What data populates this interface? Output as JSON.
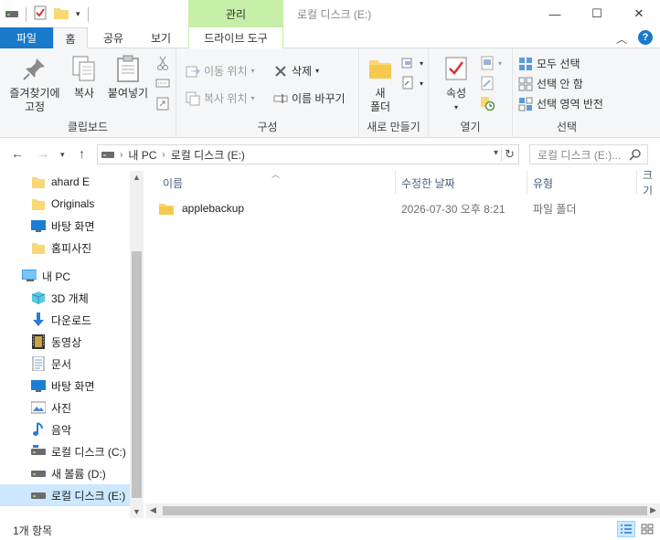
{
  "window": {
    "title": "로컬 디스크 (E:)",
    "manage_label": "관리",
    "minimize": "—",
    "maximize": "☐",
    "close": "✕"
  },
  "tabs": {
    "file": "파일",
    "home": "홈",
    "share": "공유",
    "view": "보기",
    "drive_tools": "드라이브 도구",
    "help": "?"
  },
  "ribbon": {
    "clipboard": {
      "label": "클립보드",
      "pin_line1": "즐겨찾기에",
      "pin_line2": "고정",
      "copy": "복사",
      "paste": "붙여넣기"
    },
    "organize": {
      "label": "구성",
      "move_to": "이동 위치",
      "copy_to": "복사 위치",
      "delete": "삭제",
      "rename": "이름 바꾸기"
    },
    "new": {
      "label": "새로 만들기",
      "new_folder_line1": "새",
      "new_folder_line2": "폴더"
    },
    "open": {
      "label": "열기",
      "properties": "속성"
    },
    "select": {
      "label": "선택",
      "select_all": "모두 선택",
      "select_none": "선택 안 함",
      "invert": "선택 영역 반전"
    }
  },
  "address": {
    "crumb_pc": "내 PC",
    "crumb_drive": "로컬 디스크 (E:)",
    "search_placeholder": "로컬 디스크 (E:)..."
  },
  "nav": {
    "items": [
      {
        "label": "ahard E",
        "icon": "folder-icon"
      },
      {
        "label": "Originals",
        "icon": "folder-icon"
      },
      {
        "label": "바탕 화면",
        "icon": "desktop-icon"
      },
      {
        "label": "홈피사진",
        "icon": "folder-icon"
      },
      {
        "label": "내 PC",
        "icon": "pc-icon"
      },
      {
        "label": "3D 개체",
        "icon": "cube-icon"
      },
      {
        "label": "다운로드",
        "icon": "download-icon"
      },
      {
        "label": "동영상",
        "icon": "video-icon"
      },
      {
        "label": "문서",
        "icon": "document-icon"
      },
      {
        "label": "바탕 화면",
        "icon": "desktop-icon"
      },
      {
        "label": "사진",
        "icon": "picture-icon"
      },
      {
        "label": "음악",
        "icon": "music-icon"
      },
      {
        "label": "로컬 디스크 (C:)",
        "icon": "drive-icon"
      },
      {
        "label": "새 볼륨 (D:)",
        "icon": "drive-icon"
      },
      {
        "label": "로컬 디스크 (E:)",
        "icon": "drive-icon"
      }
    ]
  },
  "columns": {
    "name": "이름",
    "modified": "수정한 날짜",
    "type": "유형",
    "size": "크기"
  },
  "files": [
    {
      "name": "applebackup",
      "modified": "2026-07-30 오후 8:21",
      "type": "파일 폴더"
    }
  ],
  "status": {
    "count": "1개 항목"
  },
  "colors": {
    "accent": "#1979ca",
    "manage_tab": "#c6efa8",
    "folder": "#f8d775",
    "selection": "#cce8ff"
  }
}
